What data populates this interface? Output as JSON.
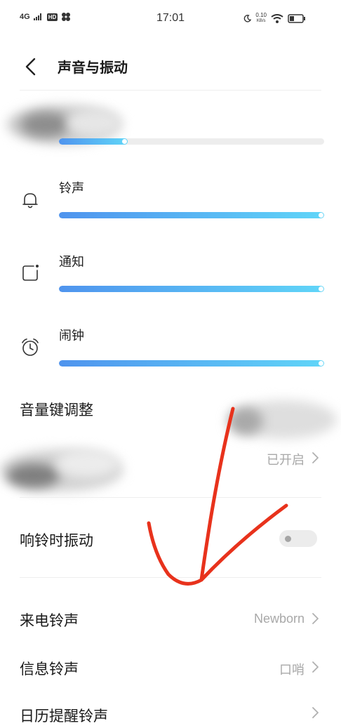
{
  "status_bar": {
    "network": "4G",
    "hd": "HD",
    "time": "17:01",
    "speed_value": "0.10",
    "speed_unit": "KB/s"
  },
  "header": {
    "title": "声音与振动"
  },
  "volume": {
    "media_level": 0.26,
    "channels": [
      {
        "label": "铃声",
        "icon": "bell-icon",
        "level": 1.0
      },
      {
        "label": "通知",
        "icon": "notification-icon",
        "level": 1.0
      },
      {
        "label": "闹钟",
        "icon": "alarm-clock-icon",
        "level": 1.0
      }
    ]
  },
  "settings": {
    "volume_keys_label": "音量键调整",
    "hidden_row_value": "已开启",
    "vibrate_on_ring_label": "响铃时振动",
    "vibrate_on_ring_state": false,
    "call_ringtone_label": "来电铃声",
    "call_ringtone_value": "Newborn",
    "message_ringtone_label": "信息铃声",
    "message_ringtone_value": "口哨",
    "calendar_ringtone_label": "日历提醒铃声"
  },
  "colors": {
    "slider_start": "#4f94ee",
    "slider_end": "#60d5f8",
    "annotation_arrow": "#e8321c"
  }
}
